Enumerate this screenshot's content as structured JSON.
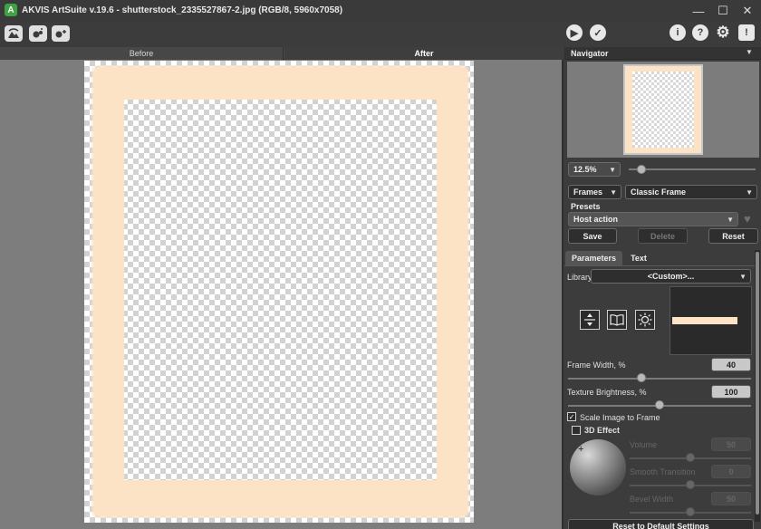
{
  "window": {
    "title": "AKVIS ArtSuite v.19.6 - shutterstock_2335527867-2.jpg (RGB/8, 5960x7058)",
    "logo_glyph": "A",
    "controls": {
      "minimize": "—",
      "maximize": "☐",
      "close": "✕"
    }
  },
  "toolbar": {
    "left_icons": [
      "open-image-icon",
      "batch-processing-icon",
      "save-preset-icon"
    ],
    "right_icons": [
      "run-icon",
      "apply-icon",
      "info-icon",
      "help-icon",
      "settings-icon",
      "notifications-icon"
    ],
    "run_glyph": "▶",
    "apply_glyph": "✓",
    "info_glyph": "i",
    "help_glyph": "?",
    "settings_glyph": "⚙",
    "notify_glyph": "!"
  },
  "view_tabs": {
    "before": "Before",
    "after": "After",
    "active": "after"
  },
  "navigator": {
    "title": "Navigator",
    "zoom_value": "12.5%",
    "zoom_slider_fraction": 0.1
  },
  "effect": {
    "category": "Frames",
    "frame_type": "Classic Frame"
  },
  "presets": {
    "label": "Presets",
    "selected": "Host action",
    "save_label": "Save",
    "delete_label": "Delete",
    "reset_label": "Reset"
  },
  "params_tabs": {
    "parameters": "Parameters",
    "text": "Text",
    "active": "parameters"
  },
  "library": {
    "label": "Library",
    "selected": "<Custom>..."
  },
  "texture_icons": [
    "flip-vertical-icon",
    "open-book-icon",
    "brightness-icon"
  ],
  "frame_width": {
    "label": "Frame Width, %",
    "value": "40",
    "fraction": 0.4
  },
  "texture_brightness": {
    "label": "Texture Brightness, %",
    "value": "100",
    "fraction": 0.5
  },
  "scale_to_frame": {
    "label": "Scale Image to Frame",
    "checked": true
  },
  "effect_3d": {
    "label": "3D Effect",
    "checked": false,
    "volume": {
      "label": "Volume",
      "value": "50"
    },
    "smooth_transition": {
      "label": "Smooth Transition",
      "value": "0"
    },
    "bevel_width": {
      "label": "Bevel Width",
      "value": "50"
    }
  },
  "reset_defaults_label": "Reset to Default Settings",
  "colors": {
    "frame_color": "#fde3c6",
    "panel_bg": "#3c3c3c",
    "canvas_bg": "#7d7d7d"
  }
}
